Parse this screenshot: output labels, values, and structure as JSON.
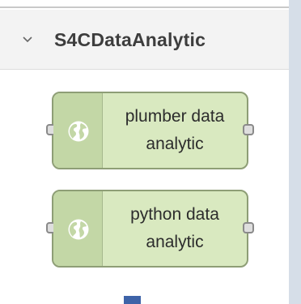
{
  "palette": {
    "category": {
      "title": "S4CDataAnalytic",
      "expanded": true,
      "chevron_icon": "chevron-down-icon"
    },
    "nodes": [
      {
        "line1": "plumber data",
        "line2": "analytic",
        "icon": "globe-icon"
      },
      {
        "line1": "python data",
        "line2": "analytic",
        "icon": "globe-icon"
      }
    ],
    "colors": {
      "node_fill": "#d9e9c0",
      "node_icon_fill": "#c3d7a6",
      "node_border": "#8e9e76",
      "header_bg": "#f3f3f3",
      "marker": "#3e63a8"
    }
  }
}
